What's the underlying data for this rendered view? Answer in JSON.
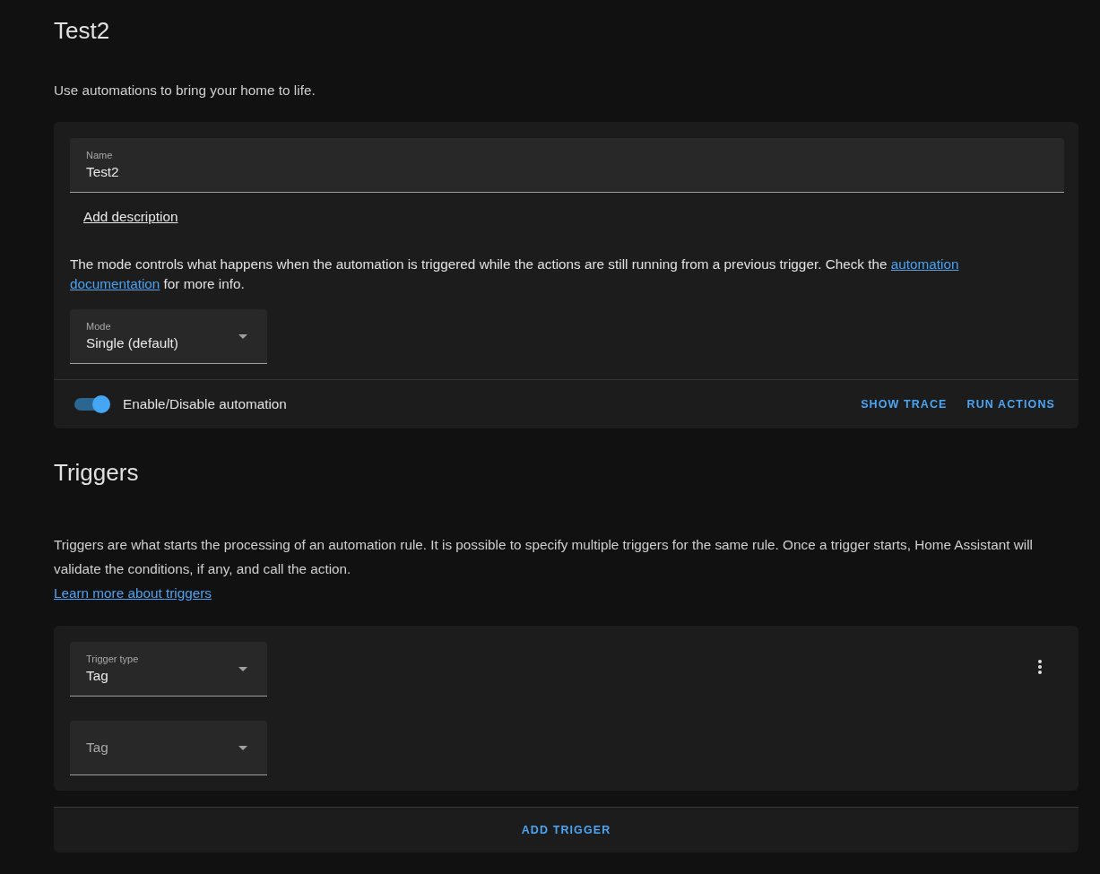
{
  "header": {
    "title": "Test2",
    "description": "Use automations to bring your home to life."
  },
  "settings_card": {
    "name_field": {
      "label": "Name",
      "value": "Test2"
    },
    "add_description_link": "Add description",
    "mode_help": [
      {
        "kind": "text",
        "text": "The mode controls what happens when the automation is triggered while the actions are still running from a previous trigger. Check the"
      },
      {
        "kind": "link",
        "text": "automation"
      },
      {
        "kind": "link",
        "text": "documentation"
      },
      {
        "kind": "text",
        "text": "for more info."
      }
    ],
    "mode_select": {
      "label": "Mode",
      "value": "Single (default)"
    },
    "enable_toggle": {
      "label": "Enable/Disable automation",
      "on": true
    },
    "actions": [
      "SHOW TRACE",
      "RUN ACTIONS"
    ]
  },
  "triggers": {
    "title": "Triggers",
    "description": "Triggers are what starts the processing of an automation rule. It is possible to specify multiple triggers for the same rule. Once a trigger starts, Home Assistant will validate the conditions, if any, and call the action.",
    "learn_more_link": "Learn more about triggers",
    "items": [
      {
        "fields": [
          {
            "label": "Trigger type",
            "value": "Tag"
          },
          {
            "placeholder": "Tag"
          }
        ]
      }
    ],
    "add_button": "ADD TRIGGER"
  }
}
